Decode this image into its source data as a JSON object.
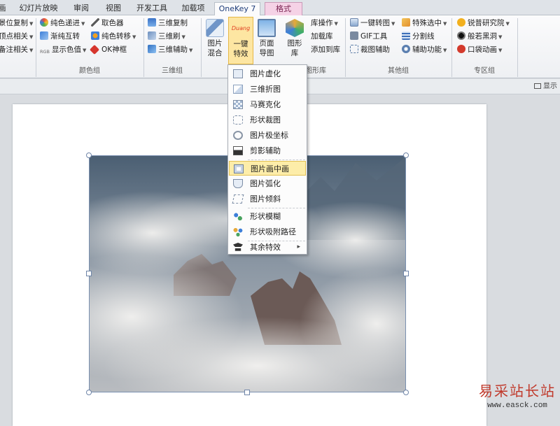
{
  "tabs": [
    {
      "label": "画"
    },
    {
      "label": "幻灯片放映"
    },
    {
      "label": "审阅"
    },
    {
      "label": "视图"
    },
    {
      "label": "开发工具"
    },
    {
      "label": "加载项"
    },
    {
      "label": "OneKey 7"
    },
    {
      "label": "格式"
    }
  ],
  "ribbon": {
    "group1": {
      "rows": [
        "景位复制",
        "顶点相关",
        "备注相关"
      ]
    },
    "color_group": {
      "label": "颜色组",
      "col1": [
        "纯色递进",
        "渐纯互转",
        "显示色值"
      ],
      "col2": [
        "取色器",
        "纯色转移",
        "OK神框"
      ],
      "rgb_badge": "RGB"
    },
    "threed_group": {
      "label": "三维组",
      "rows": [
        "三维复制",
        "三维刷",
        "三维辅助"
      ]
    },
    "image_group": {
      "mix_label": "图片混合",
      "fx_label": "一键特效",
      "fx_badge": "Duang",
      "export_label": "页面导图",
      "shapes_label": "图形库",
      "lib_rows": [
        "库操作",
        "加载库",
        "添加到库"
      ],
      "label_fragment": "图形库"
    },
    "other_group": {
      "label": "其他组",
      "col1": [
        "一键转图",
        "GIF工具",
        "裁图辅助"
      ],
      "col2": [
        "特殊选中",
        "分割线",
        "辅助功能"
      ]
    },
    "special_group": {
      "label": "专区组",
      "rows": [
        "锐普研究院",
        "般若黑洞",
        "口袋动画"
      ]
    }
  },
  "section_bar": {
    "right_label": "显示"
  },
  "menu": {
    "items": [
      "图片虚化",
      "三维折图",
      "马赛克化",
      "形状裁图",
      "图片极坐标",
      "剪影辅助",
      "图片画中画",
      "图片弧化",
      "图片倾斜",
      "形状模糊",
      "形状吸附路径",
      "其余特效"
    ],
    "highlighted": "图片画中画"
  },
  "watermark": {
    "title": "易采站长站",
    "url": "www.easck.com"
  },
  "colors": {
    "accent_tab": "#1f3d7a",
    "format_tab": "#f5d2e6",
    "menu_highlight": "#fdeda9",
    "duang": "#e03c1f"
  }
}
